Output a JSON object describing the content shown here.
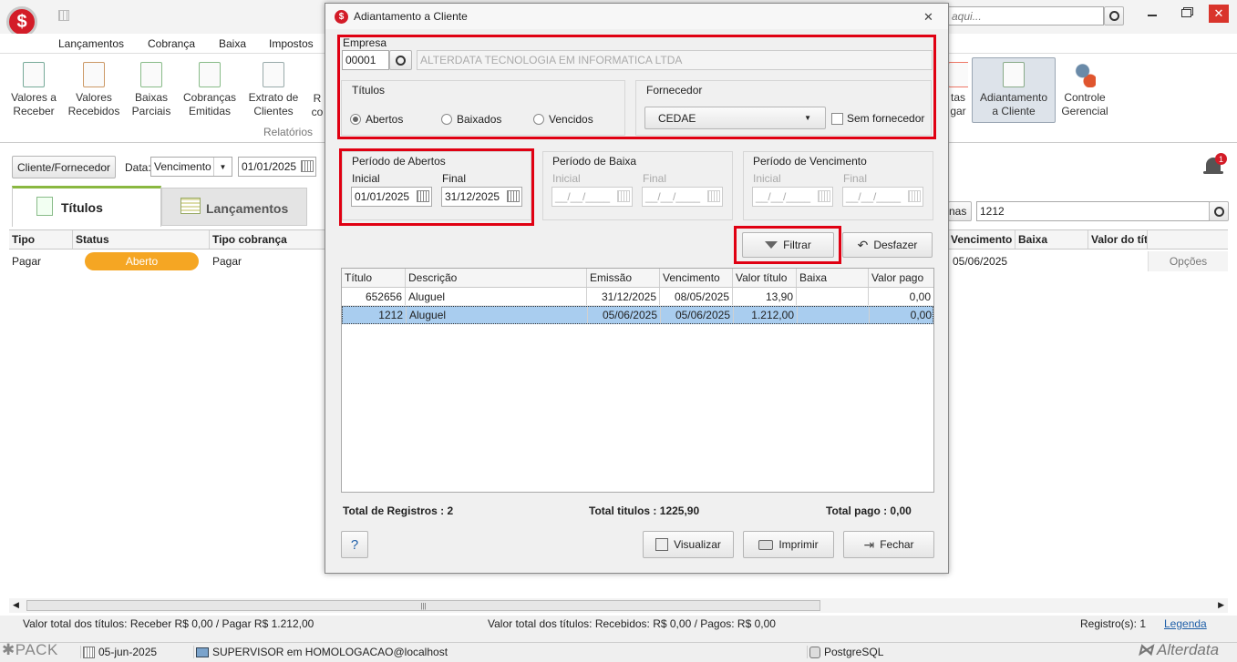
{
  "app": {
    "search_placeholder": "aqui...",
    "menu": [
      "Lançamentos",
      "Cobrança",
      "Baixa",
      "Impostos"
    ],
    "ribbon_left": [
      {
        "label1": "Valores a",
        "label2": "Receber"
      },
      {
        "label1": "Valores",
        "label2": "Recebidos"
      },
      {
        "label1": "Baixas",
        "label2": "Parciais"
      },
      {
        "label1": "Cobranças",
        "label2": "Emitidas"
      },
      {
        "label1": "Extrato de",
        "label2": "Clientes"
      },
      {
        "label1": "R",
        "label2": "co"
      }
    ],
    "ribbon_group_label": "Relatórios",
    "ribbon_right": [
      {
        "label1": "tas",
        "label2": "gar"
      },
      {
        "label1": "Adiantamento",
        "label2": "a Cliente"
      },
      {
        "label1": "Controle",
        "label2": "Gerencial"
      }
    ],
    "cliente_fornecedor_btn": "Cliente/Fornecedor",
    "data_label": "Data:",
    "data_select": "Vencimento",
    "data_date": "01/01/2025",
    "notification_count": "1",
    "tabs": [
      "Títulos",
      "Lançamentos"
    ],
    "grid_cols_left": [
      "Tipo",
      "Status",
      "Tipo cobrança"
    ],
    "grid_row_left": {
      "tipo": "Pagar",
      "status": "Aberto",
      "tipo_cobranca": "Pagar"
    },
    "right_btn_partial": "nas",
    "right_search_value": "1212",
    "grid_cols_right": [
      "Vencimento",
      "Baixa",
      "Valor do tít"
    ],
    "grid_row_right": {
      "vencimento": "05/06/2025",
      "opcoes": "Opções"
    },
    "footer_left": "Valor total dos títulos: Receber R$ 0,00 / Pagar R$ 1.212,00",
    "footer_mid": "Valor total dos títulos: Recebidos: R$ 0,00 / Pagos: R$ 0,00",
    "footer_registros": "Registro(s): 1",
    "footer_legenda": "Legenda",
    "status": {
      "pack": "PACK",
      "date": "05-jun-2025",
      "user": "SUPERVISOR em HOMOLOGACAO@localhost",
      "db": "PostgreSQL",
      "brand": "Alterdata"
    }
  },
  "dialog": {
    "title": "Adiantamento a Cliente",
    "empresa_label": "Empresa",
    "empresa_code": "00001",
    "empresa_name": "ALTERDATA TECNOLOGIA EM INFORMATICA LTDA",
    "titulos_label": "Títulos",
    "radio_abertos": "Abertos",
    "radio_baixados": "Baixados",
    "radio_vencidos": "Vencidos",
    "fornecedor_label": "Fornecedor",
    "fornecedor_value": "CEDAE",
    "sem_fornecedor": "Sem fornecedor",
    "periodo_abertos": "Período de Abertos",
    "periodo_baixa": "Período de Baixa",
    "periodo_vencimento": "Período de Vencimento",
    "inicial": "Inicial",
    "final": "Final",
    "abertos_inicial": "01/01/2025",
    "abertos_final": "31/12/2025",
    "empty_date": "__/__/____",
    "filtrar": "Filtrar",
    "desfazer": "Desfazer",
    "columns": [
      "Título",
      "Descrição",
      "Emissão",
      "Vencimento",
      "Valor título",
      "Baixa",
      "Valor pago"
    ],
    "rows": [
      {
        "titulo": "652656",
        "descricao": "Aluguel",
        "emissao": "31/12/2025",
        "vencimento": "08/05/2025",
        "valor": "13,90",
        "baixa": "",
        "pago": "0,00"
      },
      {
        "titulo": "1212",
        "descricao": "Aluguel",
        "emissao": "05/06/2025",
        "vencimento": "05/06/2025",
        "valor": "1.212,00",
        "baixa": "",
        "pago": "0,00"
      }
    ],
    "total_registros": "Total de Registros : 2",
    "total_titulos": "Total titulos : 1225,90",
    "total_pago": "Total pago : 0,00",
    "help": "?",
    "visualizar": "Visualizar",
    "imprimir": "Imprimir",
    "fechar": "Fechar"
  }
}
